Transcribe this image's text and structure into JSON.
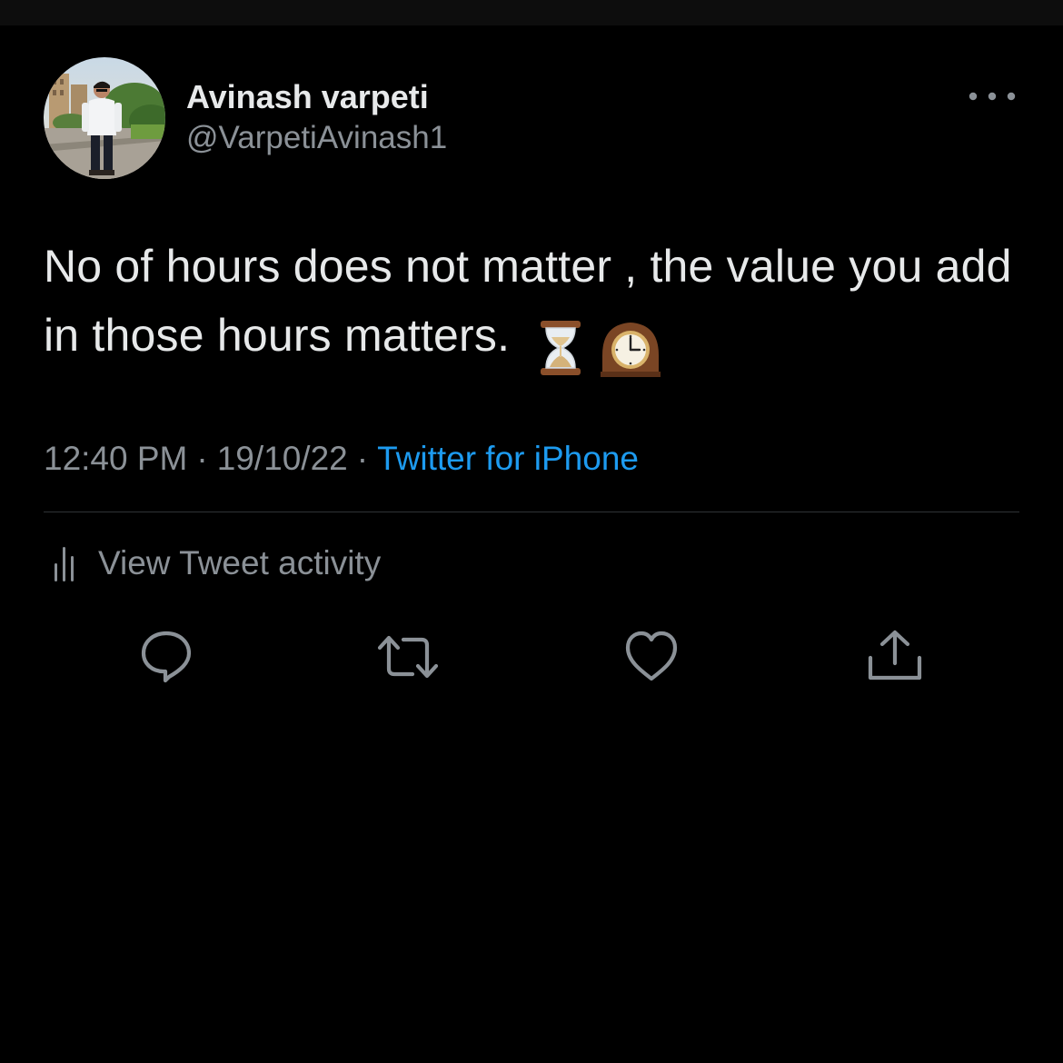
{
  "tweet": {
    "author_name": "Avinash varpeti",
    "author_handle": "@VarpetiAvinash1",
    "text": "No of hours does not matter , the value you add in those hours matters.",
    "emojis": "⏳🕰️",
    "time": "12:40 PM",
    "date": "19/10/22",
    "source": "Twitter for iPhone",
    "separator": "·"
  },
  "activity": {
    "label": "View Tweet activity"
  },
  "icons": {
    "more": "more-horizontal-icon",
    "activity": "bar-chart-icon",
    "reply": "reply-bubble-icon",
    "retweet": "retweet-icon",
    "like": "heart-icon",
    "share": "share-upload-icon"
  },
  "colors": {
    "background": "#000000",
    "primary_text": "#e7e9ea",
    "secondary_text": "#8b9197",
    "link": "#1d9bf0",
    "divider": "#2f3336"
  }
}
